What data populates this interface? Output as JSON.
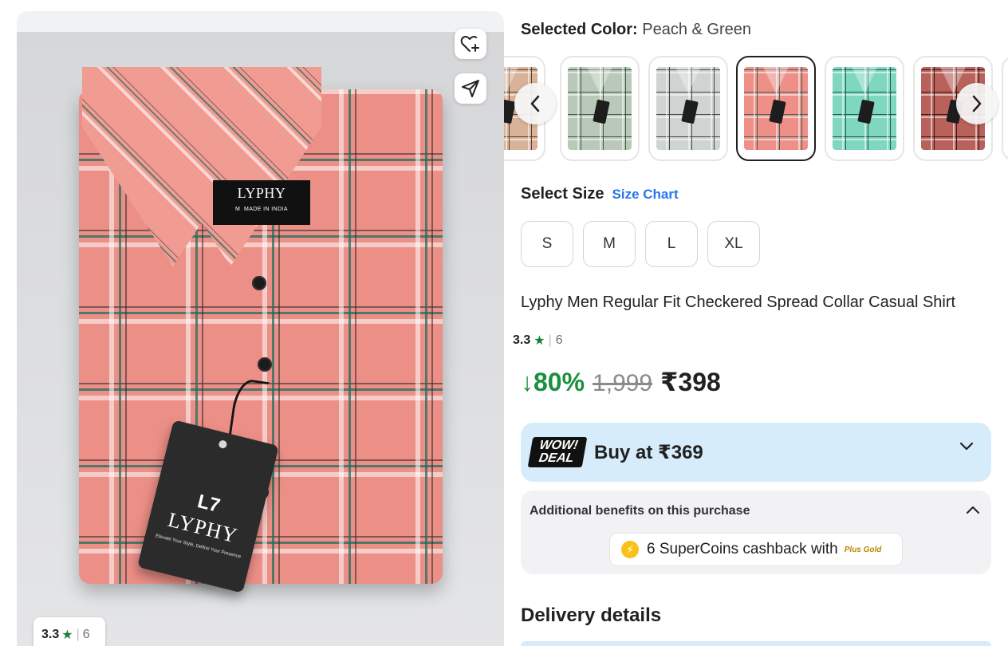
{
  "product_image": {
    "neck_label_brand": "LYPHY",
    "neck_label_size": "M",
    "neck_label_origin": "MADE IN INDIA",
    "hang_tag_logo": "L7",
    "hang_tag_brand": "LYPHY",
    "hang_tag_tagline": "Elevate Your Style, Define Your Presence",
    "rating": "3.3",
    "rating_count": "6"
  },
  "icons": {
    "wishlist": "heart-plus-icon",
    "share": "send-icon",
    "star": "star-icon",
    "prev": "chevron-left-icon",
    "next": "chevron-right-icon",
    "expand": "chevron-down-icon",
    "collapse": "chevron-up-icon",
    "coin": "supercoin-icon"
  },
  "color_selector": {
    "label": "Selected Color:",
    "value": "Peach & Green",
    "swatches": [
      {
        "name": "beige-check",
        "color": "#d8b39a",
        "line": "#5b3f2f"
      },
      {
        "name": "sage-check",
        "color": "#b9c8b8",
        "line": "#3f5a45"
      },
      {
        "name": "grey-check",
        "color": "#cfd3d2",
        "line": "#3f4a44"
      },
      {
        "name": "peach-green-check",
        "color": "#ee8f88",
        "line": "#2f6a5c",
        "selected": true
      },
      {
        "name": "mint-check",
        "color": "#7fd7c0",
        "line": "#1e5a4e"
      },
      {
        "name": "maroon-check",
        "color": "#b8625b",
        "line": "#3a1a16"
      }
    ]
  },
  "size_selector": {
    "label": "Select Size",
    "chart_link": "Size Chart",
    "sizes": [
      "S",
      "M",
      "L",
      "XL"
    ]
  },
  "product": {
    "title": "Lyphy Men Regular Fit Checkered Spread Collar Casual Shirt",
    "rating": "3.3",
    "rating_count": "6"
  },
  "price": {
    "discount": "↓80%",
    "mrp": "1,999",
    "final": "₹398"
  },
  "wow_deal": {
    "badge_line1": "WOW!",
    "badge_line2": "DEAL",
    "text": "Buy at ₹369"
  },
  "benefits": {
    "title": "Additional benefits on this purchase",
    "coin_symbol": "⚡",
    "supercoins_text": "6 SuperCoins cashback with",
    "plus_label": "Plus Gold"
  },
  "delivery": {
    "title": "Delivery details"
  },
  "colors": {
    "accent_blue": "#2874f0",
    "discount_green": "#1a8f3e",
    "rating_green": "#1a7f37",
    "deal_bg": "#d6ecfb"
  }
}
